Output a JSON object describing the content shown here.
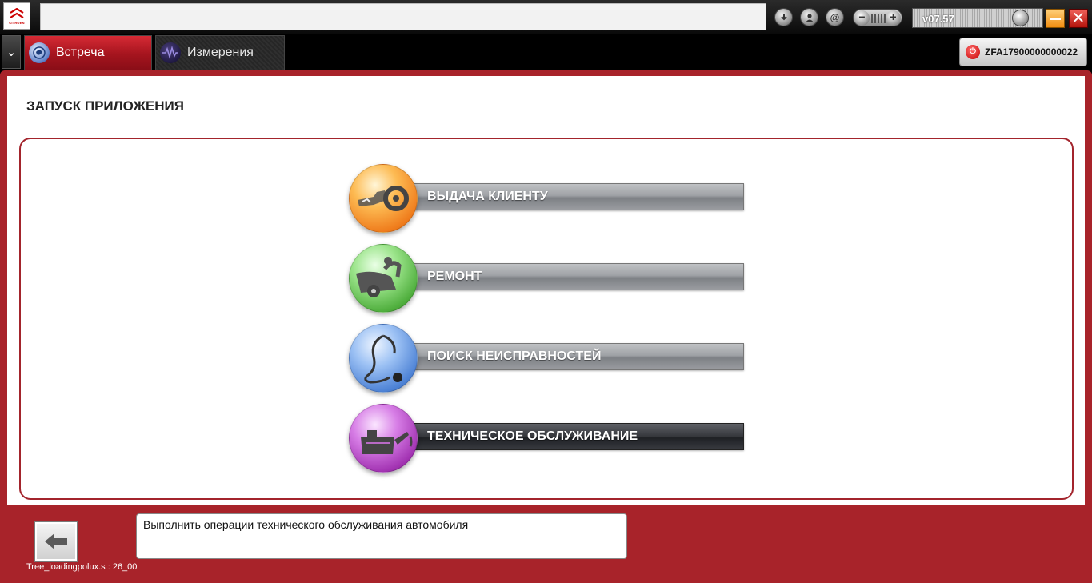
{
  "topbar": {
    "brand": "CITROËN",
    "version": "v07.57",
    "zoom_minus": "−",
    "zoom_plus": "+",
    "close_glyph": "✕"
  },
  "tabs": [
    {
      "label": "Встреча",
      "icon": "globe-icon",
      "active": true
    },
    {
      "label": "Измерения",
      "icon": "waveform-icon",
      "active": false
    }
  ],
  "vehicle": {
    "vin": "ZFA17900000000022"
  },
  "page": {
    "title": "ЗАПУСК ПРИЛОЖЕНИЯ"
  },
  "menu": [
    {
      "label": "ВЫДАЧА КЛИЕНТУ",
      "icon": "key-handover-icon",
      "color": "#f08a24",
      "selected": false
    },
    {
      "label": "РЕМОНТ",
      "icon": "car-lift-repair-icon",
      "color": "#5bbf4a",
      "selected": false
    },
    {
      "label": "ПОИСК НЕИСПРАВНОСТЕЙ",
      "icon": "stethoscope-icon",
      "color": "#4f86d6",
      "selected": false
    },
    {
      "label": "ТЕХНИЧЕСКОЕ ОБСЛУЖИВАНИЕ",
      "icon": "oil-can-icon",
      "color": "#a533b0",
      "selected": true
    }
  ],
  "footer": {
    "description": "Выполнить операции технического обслуживания автомобиля",
    "status": "Tree_loadingpolux.s : 26_00"
  }
}
